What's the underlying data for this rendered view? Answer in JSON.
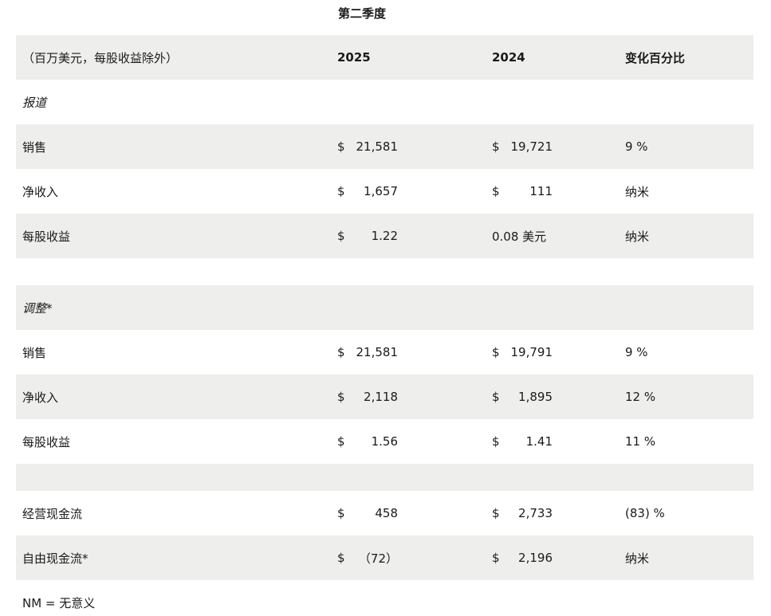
{
  "title": "第二季度",
  "header": {
    "label": "（百万美元，每股收益除外）",
    "col_2025": "2025",
    "col_2024": "2024",
    "col_change": "变化百分比"
  },
  "sections": {
    "reported": "报道",
    "adjusted": "调整*"
  },
  "rows": [
    {
      "label": "销售",
      "cur25": "$",
      "v25": "21,581",
      "cur24": "$",
      "v24": "19,721",
      "chg": "9 %"
    },
    {
      "label": "净收入",
      "cur25": "$",
      "v25": "1,657",
      "cur24": "$",
      "v24": "111",
      "chg": "纳米"
    },
    {
      "label": "每股收益",
      "cur25": "$",
      "v25": "1.22",
      "cur24": "",
      "v24": "0.08 美元",
      "chg": "纳米"
    },
    {
      "label": "销售",
      "cur25": "$",
      "v25": "21,581",
      "cur24": "$",
      "v24": "19,791",
      "chg": "9 %"
    },
    {
      "label": "净收入",
      "cur25": "$",
      "v25": "2,118",
      "cur24": "$",
      "v24": "1,895",
      "chg": "12 %"
    },
    {
      "label": "每股收益",
      "cur25": "$",
      "v25": "1.56",
      "cur24": "$",
      "v24": "1.41",
      "chg": "11 %"
    },
    {
      "label": "经营现金流",
      "cur25": "$",
      "v25": "458",
      "cur24": "$",
      "v24": "2,733",
      "chg": "(83) %"
    },
    {
      "label": "自由现金流*",
      "cur25": "$",
      "v25": "（72）",
      "cur24": "$",
      "v24": "2,196",
      "chg": "纳米"
    }
  ],
  "footnote": "NM = 无意义"
}
